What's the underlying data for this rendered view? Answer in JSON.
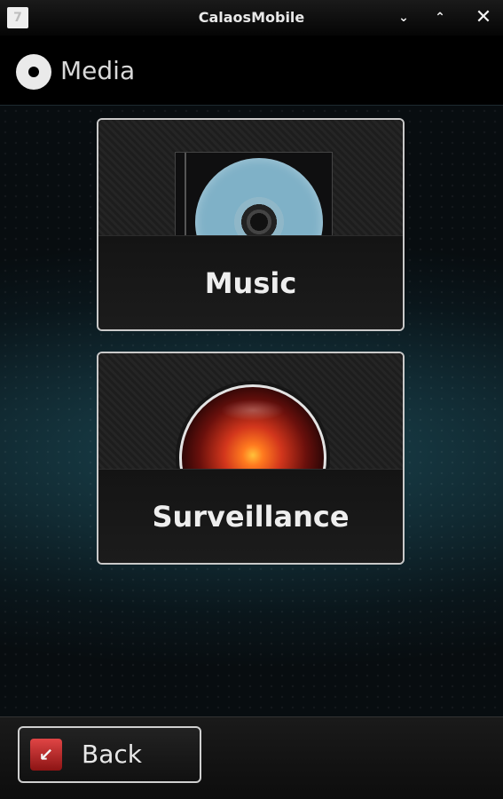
{
  "window": {
    "title": "CalaosMobile",
    "app_icon_glyph": "7",
    "controls": {
      "minimize_glyph": "⌄",
      "maximize_glyph": "⌃",
      "close_glyph": "✕"
    }
  },
  "header": {
    "icon": "disc-icon",
    "title": "Media"
  },
  "tiles": [
    {
      "icon": "cd-case-icon",
      "label": "Music"
    },
    {
      "icon": "camera-eye-icon",
      "label": "Surveillance"
    }
  ],
  "footer": {
    "back_label": "Back",
    "back_icon_glyph": "↙",
    "back_icon": "back-arrow-icon",
    "back_icon_color": "#c62828"
  }
}
